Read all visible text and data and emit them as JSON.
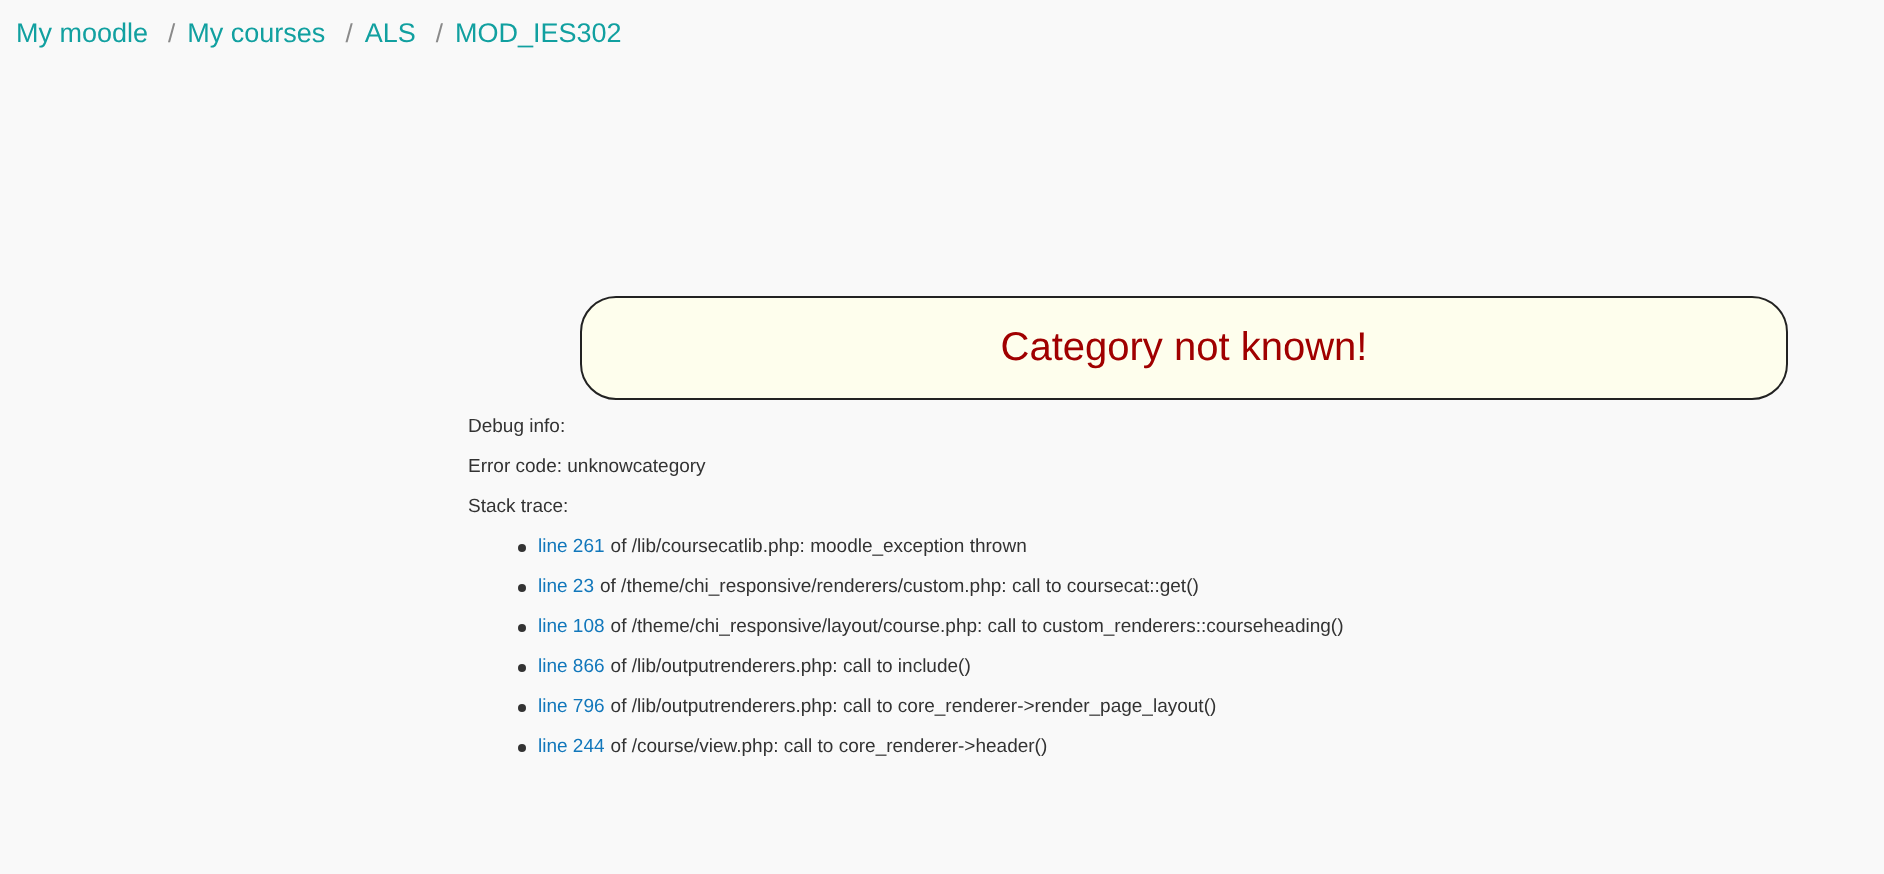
{
  "breadcrumb": {
    "separator": "/",
    "items": [
      {
        "label": "My moodle"
      },
      {
        "label": "My courses"
      },
      {
        "label": "ALS"
      },
      {
        "label": "MOD_IES302"
      }
    ]
  },
  "error_box": {
    "message": "Category not known!"
  },
  "debug": {
    "heading": "Debug info:",
    "error_code": "Error code: unknowcategory",
    "stack_heading": "Stack trace:",
    "trace": [
      {
        "line": "line 261",
        "text": "of /lib/coursecatlib.php: moodle_exception thrown"
      },
      {
        "line": "line 23",
        "text": "of /theme/chi_responsive/renderers/custom.php: call to coursecat::get()"
      },
      {
        "line": "line 108",
        "text": "of /theme/chi_responsive/layout/course.php: call to custom_renderers::courseheading()"
      },
      {
        "line": "line 866",
        "text": "of /lib/outputrenderers.php: call to include()"
      },
      {
        "line": "line 796",
        "text": "of /lib/outputrenderers.php: call to core_renderer->render_page_layout()"
      },
      {
        "line": "line 244",
        "text": "of /course/view.php: call to core_renderer->header()"
      }
    ]
  }
}
